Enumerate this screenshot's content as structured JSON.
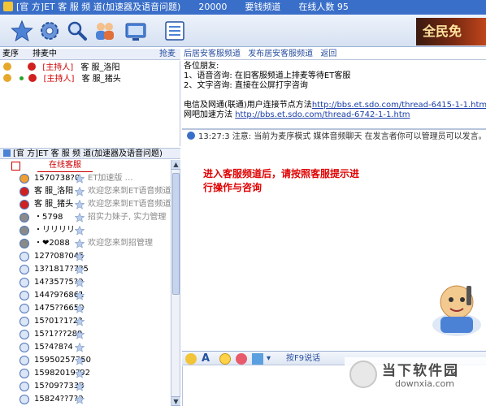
{
  "window": {
    "title_segments": [
      "[官 方]ET 客 服 频 道(加速器及语音问题)",
      "20000",
      "要钱频道",
      "在线人数 95"
    ]
  },
  "toolbar": {
    "icons": [
      "star-icon",
      "gear-icon",
      "search-icon",
      "users-icon",
      "tv-icon",
      "list-icon"
    ]
  },
  "banner": {
    "text": "全民免"
  },
  "host_panel": {
    "header": {
      "left": "麦序",
      "mid": "排麦中",
      "right": "抢麦"
    },
    "hosts": [
      {
        "role": "[主持人]",
        "name": "客 服_洛阳"
      },
      {
        "role": "[主持人]",
        "name": "客 服_猪头"
      }
    ]
  },
  "channel_tree": {
    "title": "[官 方]ET 客 服 频 道(加速器及语音问题)",
    "group_label": "在线客服"
  },
  "users": [
    {
      "name": "1570738?0",
      "extra": "ET加速版 …"
    },
    {
      "name": "客 服_洛阳",
      "extra": "欢迎您来到ET语音频道"
    },
    {
      "name": "客 服_猪头",
      "extra": "欢迎您来到ET语音频道"
    },
    {
      "name": "・5798",
      "extra": "招实力妹子, 实力管理"
    },
    {
      "name": "・リリリリ",
      "extra": ""
    },
    {
      "name": "・❤2088",
      "extra": "欢迎您来到招管理"
    },
    {
      "name": "127?08?045",
      "extra": ""
    },
    {
      "name": "13?1817?7?5",
      "extra": ""
    },
    {
      "name": "14?357?5?0",
      "extra": ""
    },
    {
      "name": "144?9?6861",
      "extra": ""
    },
    {
      "name": "1475??6650",
      "extra": ""
    },
    {
      "name": "15?01?1?2?",
      "extra": ""
    },
    {
      "name": "15?1???289",
      "extra": ""
    },
    {
      "name": "15?4?8?4",
      "extra": ""
    },
    {
      "name": "15950257750",
      "extra": ""
    },
    {
      "name": "15982019?92",
      "extra": ""
    },
    {
      "name": "15?09?7338",
      "extra": ""
    },
    {
      "name": "15824??7?0",
      "extra": ""
    }
  ],
  "right_tabs": [
    "后居安客服频道",
    "发布居安客服频道",
    "返回"
  ],
  "notice": {
    "greeting": "各位朋友:",
    "lines": [
      "1、语音咨询: 在旧客服频道上排麦等待ET客服",
      "2、文字咨询: 直接在公屏打字咨询"
    ],
    "link_prefix": "电信及网通(联通)用户连接节点方法",
    "link1": "http://bbs.et.sdo.com/thread-6415-1-1.htm",
    "link2_prefix": "网吧加速方法",
    "link2": "http://bbs.et.sdo.com/thread-6742-1-1.htm"
  },
  "system_message": "13:27:3 注意: 当前为麦序模式 媒体音频聊天 在发言者你可以管理员可以发言。",
  "chat_message": "进入客服频道后，请按照客服提示进行操作与咨询",
  "input_toolbar": {
    "label": "按F9说话",
    "icons": [
      "face-icon",
      "font-icon",
      "emoji-icon",
      "flower-icon",
      "chart-icon",
      "arrow-icon"
    ]
  },
  "watermark": {
    "title": "当下软件园",
    "url": "downxia.com"
  },
  "colors": {
    "titlebar": "#3a6fc9",
    "chat_message": "#e00000",
    "role": "#d00000",
    "link": "#1b3fa8"
  }
}
